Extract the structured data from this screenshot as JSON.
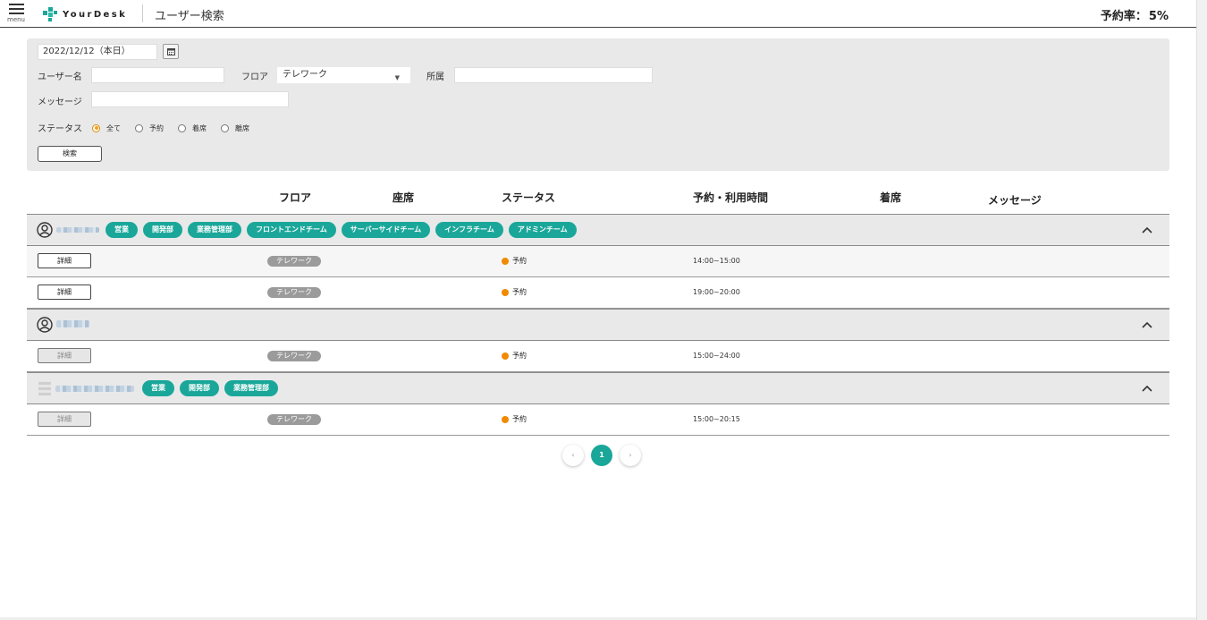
{
  "header": {
    "menu_label": "menu",
    "brand": "YourDesk",
    "title": "ユーザー検索",
    "rate_label": "予約率：",
    "rate_value": "5%"
  },
  "search": {
    "date_value": "2022/12/12（本日）",
    "user_label": "ユーザー名",
    "user_value": "",
    "floor_label": "フロア",
    "floor_value": "テレワーク",
    "dept_label": "所属",
    "dept_value": "",
    "message_label": "メッセージ",
    "message_value": "",
    "status_label": "ステータス",
    "status_options": [
      "全て",
      "予約",
      "着席",
      "離席"
    ],
    "status_selected": "全て",
    "button": "検索"
  },
  "columns": [
    "フロア",
    "座席",
    "ステータス",
    "予約・利用時間",
    "着席",
    "メッセージ"
  ],
  "groups": [
    {
      "tags": [
        "営業",
        "開発部",
        "業務管理部",
        "フロントエンドチーム",
        "サーバーサイドチーム",
        "インフラチーム",
        "アドミンチーム"
      ],
      "rows": [
        {
          "detail": "詳細",
          "floor": "テレワーク",
          "status": "予約",
          "time": "14:00~15:00"
        },
        {
          "detail": "詳細",
          "floor": "テレワーク",
          "status": "予約",
          "time": "19:00~20:00"
        }
      ]
    },
    {
      "tags": [],
      "rows": [
        {
          "detail": "詳細",
          "floor": "テレワーク",
          "status": "予約",
          "time": "15:00~24:00"
        }
      ]
    },
    {
      "tags": [
        "営業",
        "開発部",
        "業務管理部"
      ],
      "rows": [
        {
          "detail": "詳細",
          "floor": "テレワーク",
          "status": "予約",
          "time": "15:00~20:15"
        }
      ]
    }
  ],
  "pagination": {
    "prev": "‹",
    "current": "1",
    "next": "›"
  },
  "colors": {
    "accent": "#1aa79a",
    "status_reserved": "#f08a00",
    "floor_pill": "#9b9b9b"
  },
  "icons": [
    "menu-icon",
    "calendar-icon",
    "dropdown-arrow-icon",
    "user-avatar-icon",
    "chevron-up-icon"
  ]
}
